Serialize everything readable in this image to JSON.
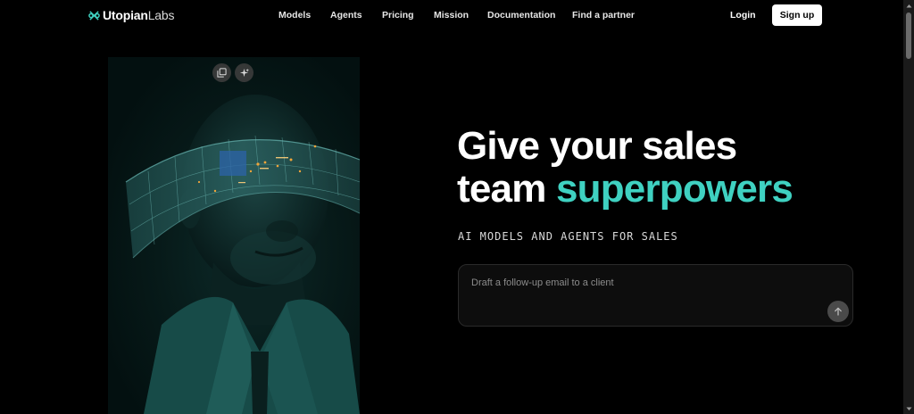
{
  "brand": {
    "name_strong": "Utopian",
    "name_light": "Labs",
    "logo_icon": "utopian-labs-logo",
    "accent_color": "#3fd1c1"
  },
  "nav": {
    "links": [
      "Models",
      "Agents",
      "Pricing",
      "Mission",
      "Documentation",
      "Find a partner"
    ],
    "login_label": "Login",
    "signup_label": "Sign up"
  },
  "image_actions": {
    "icons": [
      "gallery-icon",
      "sparkle-icon"
    ]
  },
  "hero": {
    "title_line1": "Give your sales",
    "title_line2_plain": "team ",
    "title_line2_accent": "superpowers",
    "subtitle": "AI MODELS AND AGENTS FOR SALES"
  },
  "prompt": {
    "placeholder": "Draft a follow-up email to a client",
    "value": "",
    "send_icon": "arrow-up-icon"
  },
  "colors": {
    "background": "#000000",
    "accent": "#3fd1c1",
    "button_bg": "#ffffff"
  }
}
